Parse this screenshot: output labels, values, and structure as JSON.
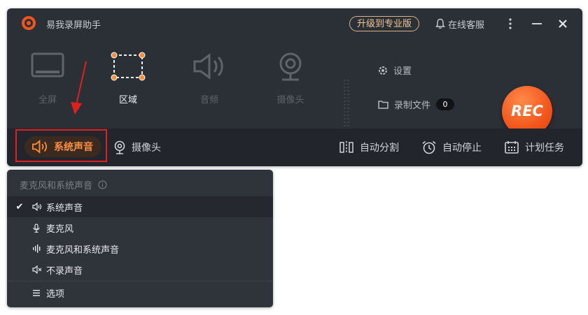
{
  "app": {
    "title": "易我录屏助手",
    "upgrade_label": "升级到专业版",
    "support_label": "在线客服",
    "brand_color": "#f2551a"
  },
  "modes": [
    {
      "label": "全屏",
      "icon": "monitor-icon",
      "active": false
    },
    {
      "label": "区域",
      "icon": "region-select-icon",
      "active": true
    },
    {
      "label": "音频",
      "icon": "speaker-icon",
      "active": false
    },
    {
      "label": "摄像头",
      "icon": "webcam-icon",
      "active": false
    }
  ],
  "side": {
    "settings_label": "设置",
    "files_label": "录制文件",
    "files_count": "0"
  },
  "rec_label": "REC",
  "bottombar": {
    "system_sound_label": "系统声音",
    "camera_label": "摄像头",
    "auto_split_label": "自动分割",
    "auto_stop_label": "自动停止",
    "schedule_label": "计划任务"
  },
  "menu": {
    "header": "麦克风和系统声音",
    "items": [
      {
        "label": "系统声音",
        "icon": "speaker-icon",
        "selected": true
      },
      {
        "label": "麦克风",
        "icon": "microphone-icon",
        "selected": false
      },
      {
        "label": "麦克风和系统声音",
        "icon": "waveform-icon",
        "selected": false
      },
      {
        "label": "不录声音",
        "icon": "mute-icon",
        "selected": false
      }
    ],
    "options_label": "选项"
  }
}
